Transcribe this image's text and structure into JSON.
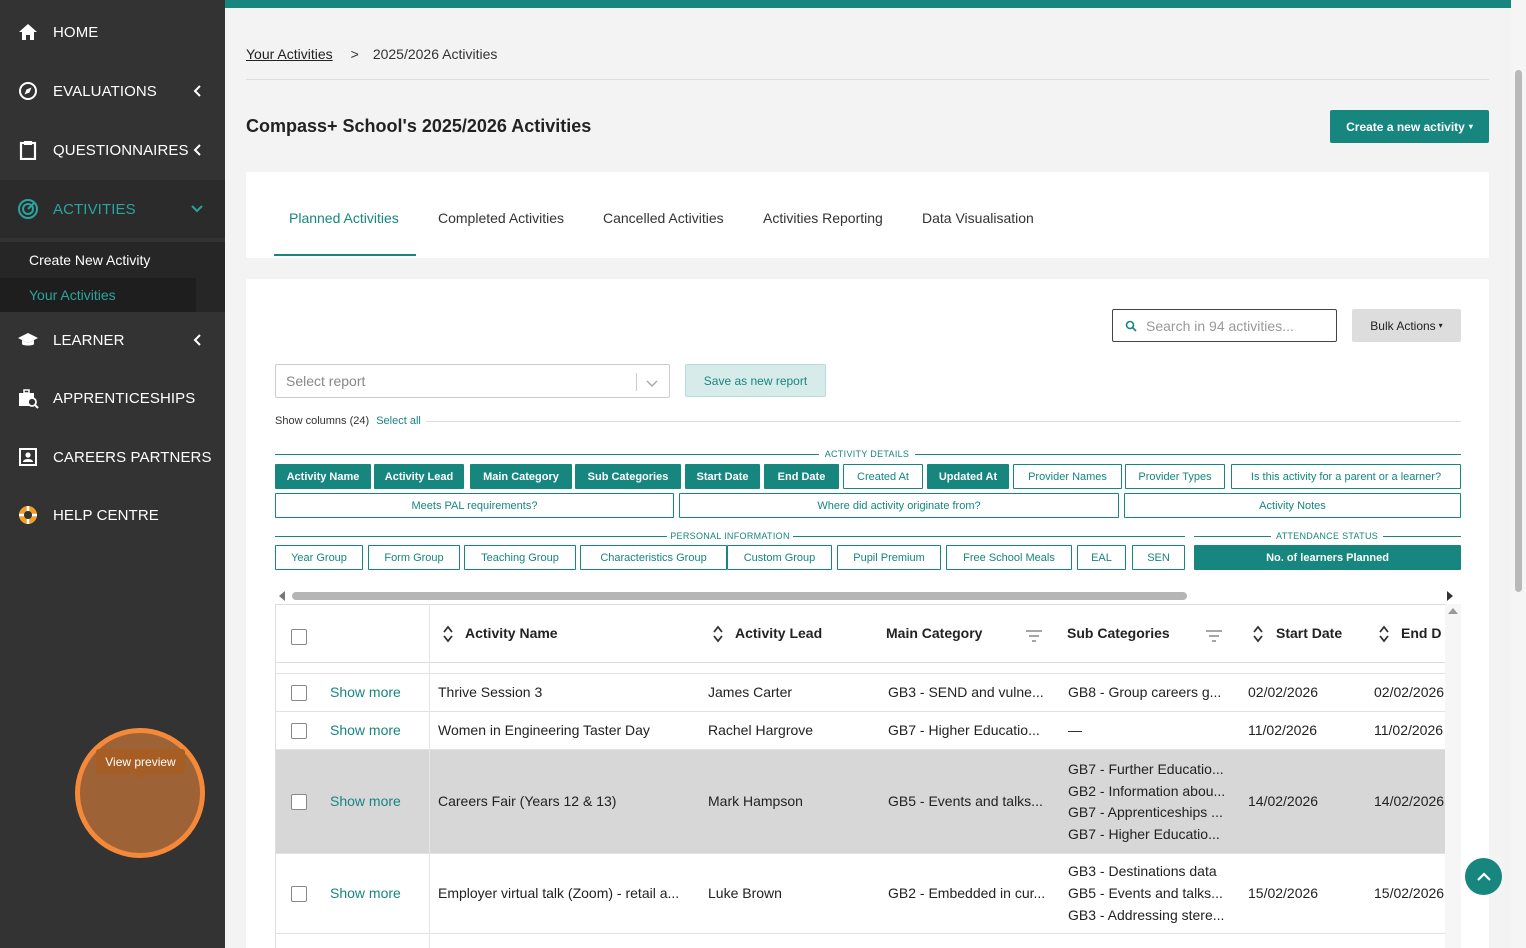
{
  "sidebar": {
    "items": [
      {
        "label": "HOME",
        "icon": "home-icon"
      },
      {
        "label": "EVALUATIONS",
        "icon": "compass-icon"
      },
      {
        "label": "QUESTIONNAIRES",
        "icon": "clipboard-icon"
      },
      {
        "label": "ACTIVITIES",
        "icon": "activities-icon"
      },
      {
        "label": "LEARNER",
        "icon": "graduation-cap-icon"
      },
      {
        "label": "APPRENTICESHIPS",
        "icon": "briefcase-search-icon"
      },
      {
        "label": "CAREERS PARTNERS",
        "icon": "contact-card-icon"
      },
      {
        "label": "HELP CENTRE",
        "icon": "lifebuoy-icon"
      }
    ],
    "subitems": [
      {
        "label": "Create New Activity"
      },
      {
        "label": "Your Activities"
      }
    ]
  },
  "breadcrumb": {
    "link": "Your Activities",
    "separator": ">",
    "current": "2025/2026 Activities"
  },
  "page_title": "Compass+ School's 2025/2026 Activities",
  "create_button": "Create a new activity",
  "tabs": [
    {
      "label": "Planned Activities",
      "active": true
    },
    {
      "label": "Completed Activities"
    },
    {
      "label": "Cancelled Activities"
    },
    {
      "label": "Activities Reporting"
    },
    {
      "label": "Data Visualisation"
    }
  ],
  "search": {
    "placeholder": "Search in 94 activities..."
  },
  "bulk_actions": "Bulk Actions",
  "select_report": {
    "placeholder": "Select report"
  },
  "save_report": "Save as new report",
  "show_columns": {
    "label": "Show columns (24)",
    "select_all": "Select all"
  },
  "sections": {
    "activity_details": "ACTIVITY DETAILS",
    "personal_information": "PERSONAL INFORMATION",
    "attendance_status": "ATTENDANCE STATUS"
  },
  "column_chips": {
    "activity_details_row1": [
      {
        "label": "Activity Name",
        "on": true
      },
      {
        "label": "Activity Lead",
        "on": true
      },
      {
        "label": "Main Category",
        "on": true
      },
      {
        "label": "Sub Categories",
        "on": true
      },
      {
        "label": "Start Date",
        "on": true
      },
      {
        "label": "End Date",
        "on": true
      },
      {
        "label": "Created At",
        "on": false
      },
      {
        "label": "Updated At",
        "on": true
      },
      {
        "label": "Provider Names",
        "on": false
      },
      {
        "label": "Provider Types",
        "on": false
      },
      {
        "label": "Is this activity for a parent or a learner?",
        "on": false
      }
    ],
    "activity_details_row2": [
      {
        "label": "Meets PAL requirements?",
        "on": false
      },
      {
        "label": "Where did activity originate from?",
        "on": false
      },
      {
        "label": "Activity Notes",
        "on": false
      }
    ],
    "personal_information": [
      {
        "label": "Year Group",
        "on": false
      },
      {
        "label": "Form Group",
        "on": false
      },
      {
        "label": "Teaching Group",
        "on": false
      },
      {
        "label": "Characteristics Group",
        "on": false
      },
      {
        "label": "Custom Group",
        "on": false
      },
      {
        "label": "Pupil Premium",
        "on": false
      },
      {
        "label": "Free School Meals",
        "on": false
      },
      {
        "label": "EAL",
        "on": false
      },
      {
        "label": "SEN",
        "on": false
      }
    ],
    "attendance_status": [
      {
        "label": "No. of learners Planned",
        "on": true
      }
    ]
  },
  "table": {
    "headers": {
      "activity_name": "Activity Name",
      "activity_lead": "Activity Lead",
      "main_category": "Main Category",
      "sub_categories": "Sub Categories",
      "start_date": "Start Date",
      "end_date": "End D"
    },
    "show_more": "Show more",
    "rows": [
      {
        "name": "Thrive Session 3",
        "lead": "James Carter",
        "main": "GB3 - SEND and vulne...",
        "subs": [
          "GB8 - Group careers g..."
        ],
        "start": "02/02/2026",
        "end": "02/02/2026"
      },
      {
        "name": "Women in Engineering Taster Day",
        "lead": "Rachel Hargrove",
        "main": "GB7 - Higher Educatio...",
        "subs": [
          "—"
        ],
        "start": "11/02/2026",
        "end": "11/02/2026"
      },
      {
        "name": "Careers Fair (Years 12 & 13)",
        "lead": "Mark Hampson",
        "main": "GB5 - Events and talks...",
        "subs": [
          "GB7 - Further Educatio...",
          "GB2 - Information abou...",
          "GB7 - Apprenticeships ...",
          "GB7 - Higher Educatio..."
        ],
        "start": "14/02/2026",
        "end": "14/02/2026"
      },
      {
        "name": "Employer virtual talk (Zoom) - retail a...",
        "lead": "Luke Brown",
        "main": "GB2 - Embedded in cur...",
        "subs": [
          "GB3 - Destinations data",
          "GB5 - Events and talks...",
          "GB3 - Addressing stere..."
        ],
        "start": "15/02/2026",
        "end": "15/02/2026"
      }
    ]
  },
  "tooltip": "View preview",
  "colors": {
    "brand": "#16867f",
    "sidebar": "#333333",
    "highlight": "#f5893a"
  }
}
